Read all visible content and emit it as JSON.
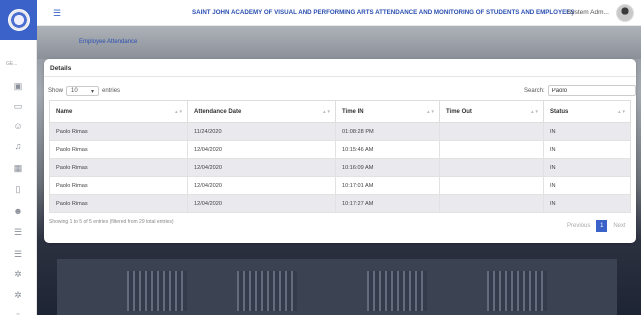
{
  "header": {
    "title": "SAINT JOHN ACADEMY OF VISUAL AND PERFORMING ARTS ATTENDANCE AND MONITORING OF STUDENTS AND EMPLOYEES",
    "user_name": "System Adm...",
    "menu_icon": "hamburger-icon"
  },
  "sidebar": {
    "section_label": "GE...",
    "icons": [
      "dashboard-icon",
      "message-icon",
      "users-icon",
      "bell-icon",
      "calendar-icon",
      "tablet-icon",
      "people-icon",
      "list-icon",
      "list-icon",
      "gear-icon",
      "gear-icon",
      "more-icon"
    ]
  },
  "page": {
    "title": "Employee Attendance"
  },
  "card": {
    "title": "Details",
    "show_label": "Show",
    "entries_value": "10",
    "entries_label": "entries",
    "search_label": "Search:",
    "search_value": "Paolo"
  },
  "table": {
    "columns": [
      "Name",
      "Attendance Date",
      "Time IN",
      "Time Out",
      "Status"
    ],
    "rows": [
      [
        "Paolo Rimas",
        "11/24/2020",
        "01:08:28 PM",
        "",
        "IN"
      ],
      [
        "Paolo Rimas",
        "12/04/2020",
        "10:15:46 AM",
        "",
        "IN"
      ],
      [
        "Paolo Rimas",
        "12/04/2020",
        "10:16:09 AM",
        "",
        "IN"
      ],
      [
        "Paolo Rimas",
        "12/04/2020",
        "10:17:01 AM",
        "",
        "IN"
      ],
      [
        "Paolo Rimas",
        "12/04/2020",
        "10:17:27 AM",
        "",
        "IN"
      ]
    ]
  },
  "footer": {
    "info": "Showing 1 to 5 of 5 entries (filtered from 29 total entries)",
    "previous": "Previous",
    "current_page": "1",
    "next": "Next"
  },
  "colors": {
    "accent": "#3a62c9",
    "title": "#2a4fb0"
  }
}
